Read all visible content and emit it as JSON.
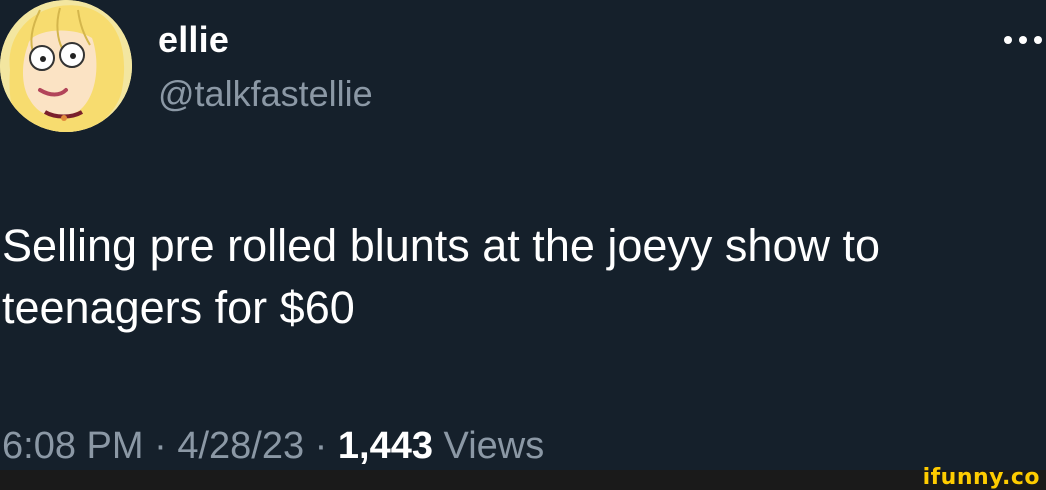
{
  "tweet": {
    "author": {
      "display_name": "ellie",
      "handle": "@talkfastellie"
    },
    "text": "Selling pre rolled blunts at the joeyy show to\nteenagers for $60",
    "time": "6:08 PM",
    "date": "4/28/23",
    "separator": "·",
    "views_count": "1,443",
    "views_label": "Views"
  },
  "watermark": {
    "text": "ifunny.co"
  },
  "colors": {
    "background": "#15202b",
    "primary_text": "#ffffff",
    "secondary_text": "#8b98a5",
    "watermark": "#ffcc00"
  },
  "icons": {
    "more": "more-horizontal-icon",
    "avatar": "avatar-cartoon-girl"
  }
}
